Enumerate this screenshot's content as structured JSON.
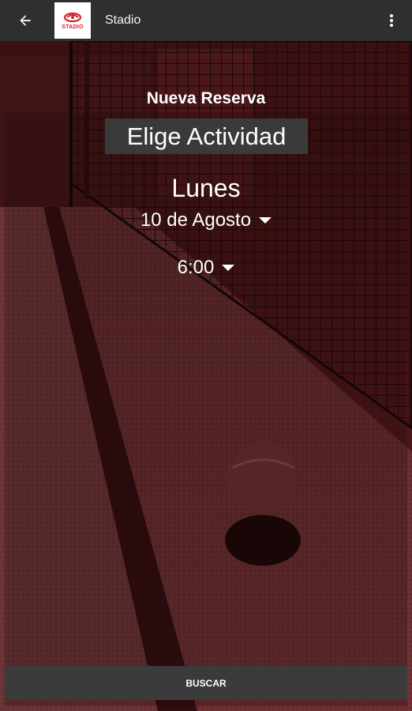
{
  "app_bar": {
    "title": "Stadio",
    "logo_text": "STADIO",
    "back_icon": "arrow-left-icon",
    "menu_icon": "more-vertical-icon"
  },
  "form": {
    "title": "Nueva Reserva",
    "activity_label": "Elige Actividad",
    "day": "Lunes",
    "date": "10 de Agosto",
    "time": "6:00"
  },
  "search_button": "BUSCAR",
  "colors": {
    "app_bar": "#2f2f2f",
    "overlay": "#7a1218",
    "brand_red": "#d6232a"
  }
}
